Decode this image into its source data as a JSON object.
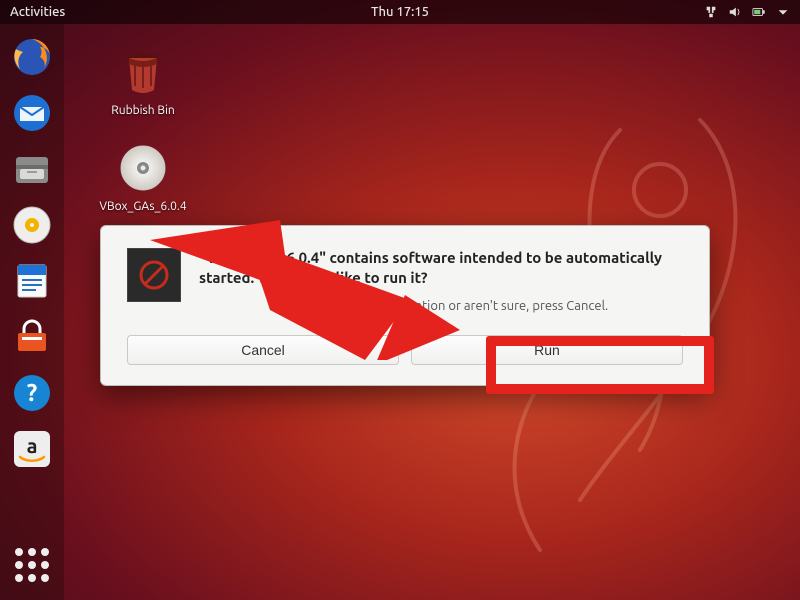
{
  "topbar": {
    "activities": "Activities",
    "clock": "Thu 17:15"
  },
  "desktop_icons": {
    "trash": "Rubbish Bin",
    "disc": "VBox_GAs_6.0.4"
  },
  "dock": {
    "items": [
      "firefox",
      "thunderbird",
      "files",
      "rhythmbox",
      "writer",
      "software",
      "help",
      "amazon"
    ],
    "apps_button": "Show Applications"
  },
  "dialog": {
    "title": "\"VBox_GAs_6.0.4\" contains software intended to be automatically started. Would you like to run it?",
    "subtext": "If you don't trust this location or aren't sure, press Cancel.",
    "cancel": "Cancel",
    "run": "Run"
  }
}
